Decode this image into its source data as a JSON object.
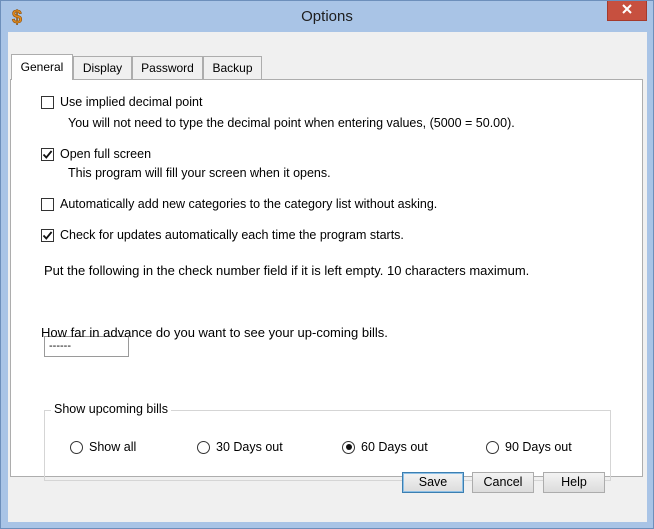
{
  "window": {
    "title": "Options",
    "app_icon": "dollar-icon",
    "close_icon": "close-icon"
  },
  "tabs": [
    {
      "label": "General",
      "active": true
    },
    {
      "label": "Display",
      "active": false
    },
    {
      "label": "Password",
      "active": false
    },
    {
      "label": "Backup",
      "active": false
    }
  ],
  "options": {
    "implied_decimal": {
      "label": "Use implied decimal point",
      "checked": false,
      "desc": "You will not need to type the decimal point when entering values,  (5000 = 50.00)."
    },
    "full_screen": {
      "label": "Open full screen",
      "checked": true,
      "desc": "This program will fill your screen when it opens."
    },
    "auto_categories": {
      "label": "Automatically add new categories to the category list without asking.",
      "checked": false
    },
    "check_updates": {
      "label": "Check for updates automatically each time the program starts.",
      "checked": true
    }
  },
  "check_number": {
    "label": "Put the following in the check number field if it is left empty. 10 characters maximum.",
    "value": "------"
  },
  "advance": {
    "label": "How far in advance do you want to see your up-coming bills.",
    "group_title": "Show upcoming bills",
    "choices": [
      "Show all",
      "30 Days out",
      "60 Days out",
      "90 Days out"
    ],
    "selected": "60 Days out"
  },
  "buttons": {
    "save": "Save",
    "cancel": "Cancel",
    "help": "Help"
  }
}
